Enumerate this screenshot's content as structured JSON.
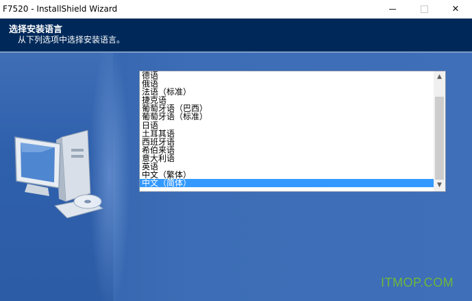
{
  "window": {
    "title": "F7520 - InstallShield Wizard"
  },
  "header": {
    "title": "选择安装语言",
    "subtitle": "从下列选项中选择安装语言。"
  },
  "language_list": {
    "items": [
      "德语",
      "俄语",
      "法语（标准）",
      "捷克语",
      "葡萄牙语（巴西）",
      "葡萄牙语（标准）",
      "日语",
      "土耳其语",
      "西班牙语",
      "希伯来语",
      "意大利语",
      "英语",
      "中文（繁体）",
      "中文（简体）"
    ],
    "selected": "中文（简体）"
  },
  "watermark": "ITMOP.COM",
  "colors": {
    "header_bg": "#00295a",
    "body_bg": "#3c6db6",
    "selection": "#3399ff",
    "watermark": "#6fb83a"
  }
}
